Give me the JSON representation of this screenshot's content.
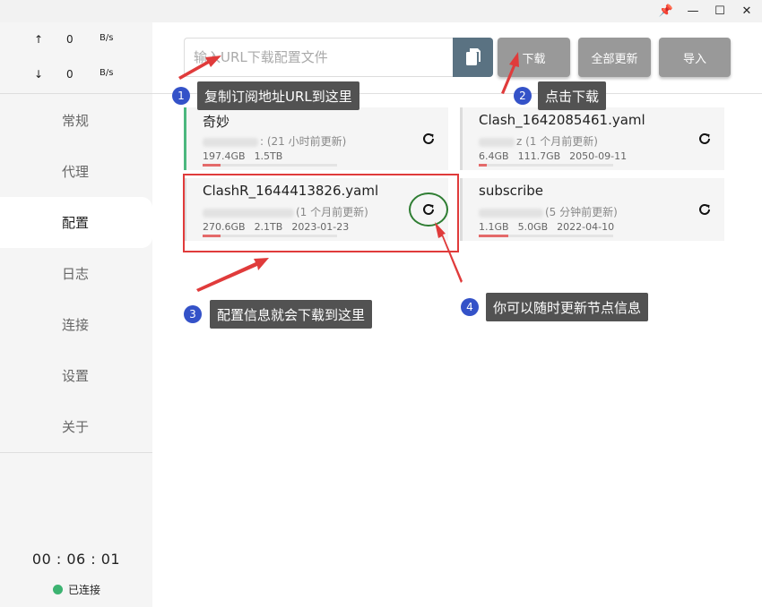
{
  "window_controls": {
    "pin_glyph": "📌",
    "minimize_glyph": "—",
    "maximize_glyph": "☐",
    "close_glyph": "✕"
  },
  "sidebar": {
    "traffic": {
      "up": {
        "arrow": "↑",
        "value": "0",
        "unit": "B/s"
      },
      "down": {
        "arrow": "↓",
        "value": "0",
        "unit": "B/s"
      }
    },
    "nav": [
      {
        "label": "常规"
      },
      {
        "label": "代理"
      },
      {
        "label": "配置"
      },
      {
        "label": "日志"
      },
      {
        "label": "连接"
      },
      {
        "label": "设置"
      },
      {
        "label": "关于"
      }
    ],
    "active_index": 2,
    "timer": "00 : 06 : 01",
    "status": "已连接",
    "status_color": "#3cb371"
  },
  "toolbar": {
    "url_placeholder": "输入URL下载配置文件",
    "download_label": "下载",
    "update_all_label": "全部更新",
    "import_label": "导入"
  },
  "profiles": [
    {
      "name": "奇妙",
      "updated": ": (21 小时前更新)",
      "used": "197.4GB",
      "total": "1.5TB",
      "expire": "",
      "usage_fraction": 0.13,
      "active": true
    },
    {
      "name": "Clash_1642085461.yaml",
      "updated": "z (1 个月前更新)",
      "used": "6.4GB",
      "total": "111.7GB",
      "expire": "2050-09-11",
      "usage_fraction": 0.06,
      "active": false
    },
    {
      "name": "ClashR_1644413826.yaml",
      "updated": "(1 个月前更新)",
      "used": "270.6GB",
      "total": "2.1TB",
      "expire": "2023-01-23",
      "usage_fraction": 0.13,
      "active": false
    },
    {
      "name": "subscribe",
      "updated": "(5 分钟前更新)",
      "used": "1.1GB",
      "total": "5.0GB",
      "expire": "2022-04-10",
      "usage_fraction": 0.22,
      "active": false
    }
  ],
  "annotations": [
    {
      "number": "1",
      "text": "复制订阅地址URL到这里"
    },
    {
      "number": "2",
      "text": "点击下载"
    },
    {
      "number": "3",
      "text": "配置信息就会下载到这里"
    },
    {
      "number": "4",
      "text": "你可以随时更新节点信息"
    }
  ],
  "colors": {
    "accent_active": "#4cb87f",
    "badge": "#3452c8",
    "callout": "#525252",
    "highlight_red": "#e03b3b",
    "highlight_green": "#2e7d32",
    "usage_bar": "#e46a6a"
  }
}
